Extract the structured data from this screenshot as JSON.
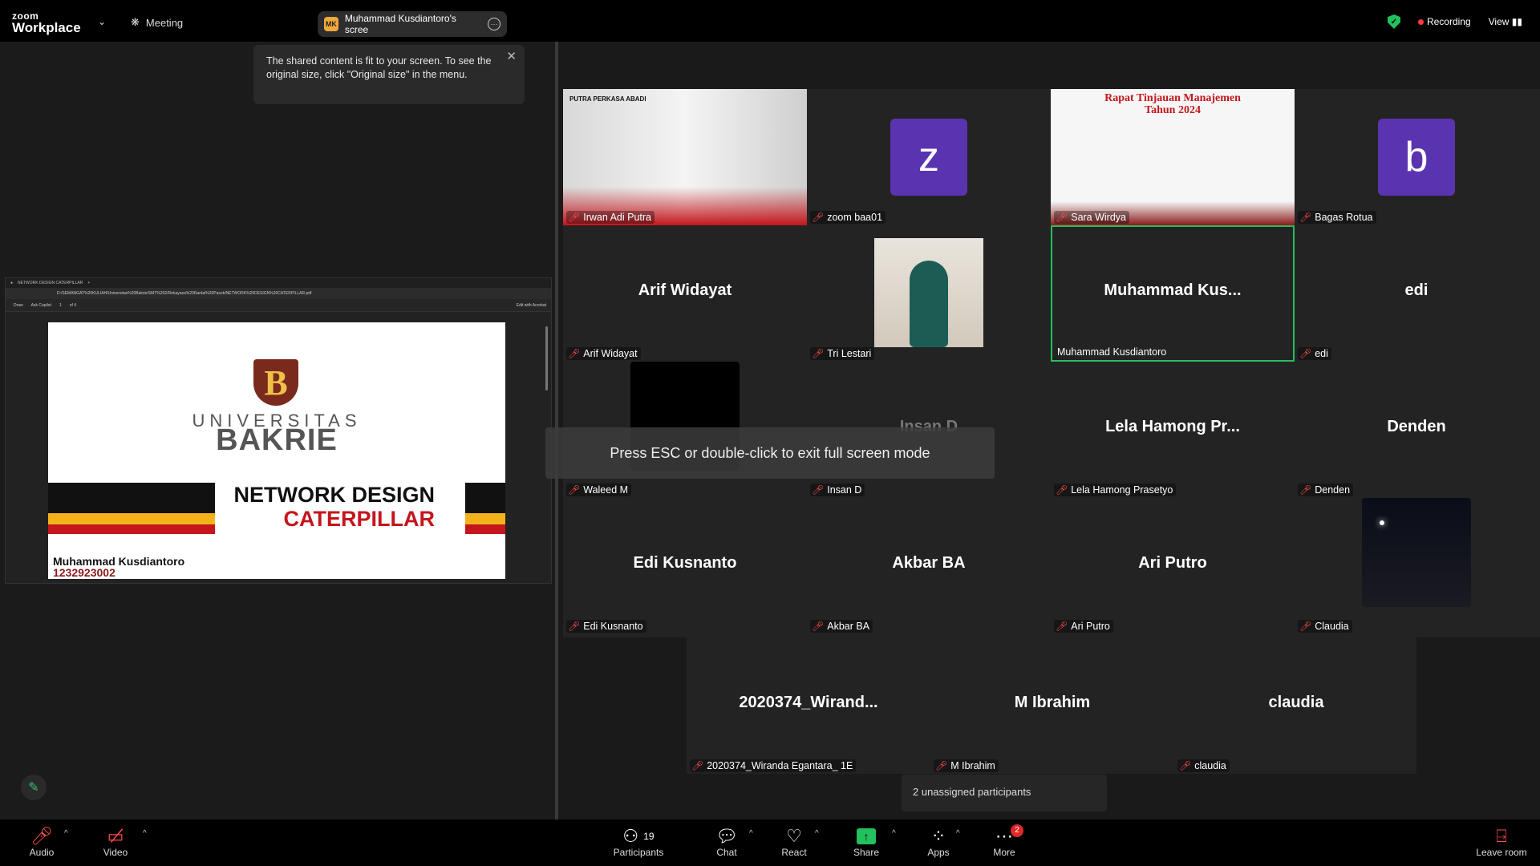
{
  "topbar": {
    "logo_line1": "zoom",
    "logo_line2": "Workplace",
    "meeting_label": "Meeting",
    "share_pill_initials": "MK",
    "share_pill_label": "Muhammad Kusdiantoro's scree",
    "recording_label": "Recording",
    "view_label": "View"
  },
  "tooltip": {
    "text": "The shared content is fit to your screen. To see the original size, click \"Original size\" in the menu."
  },
  "shared_screen": {
    "tab_title": "NETWORK DESIGN CATERPILLAR",
    "address": "D:/SEMANGAT%20KULIAH/Universitas%20Bakrie/SMT%202/Rekayasa%20Rantai%20Pasok/NETWORK%20DESIGN%20CATERPILLAR.pdf",
    "toolbar_draw": "Draw",
    "toolbar_copilot": "Ask Copilot",
    "toolbar_page": "1",
    "toolbar_of": "of 4",
    "toolbar_acrobat": "Edit with Acrobat",
    "slide": {
      "crest_letter": "B",
      "univ_line1": "UNIVERSITAS",
      "univ_line2": "BAKRIE",
      "title_line1": "NETWORK DESIGN",
      "title_line2": "CATERPILLAR",
      "author": "Muhammad Kusdiantoro",
      "nim": "1232923002"
    }
  },
  "gallery": {
    "tiles": [
      {
        "label": "Irwan Adi Putra",
        "name": ""
      },
      {
        "label": "zoom baa01",
        "name": "",
        "avatar": "z"
      },
      {
        "label": "Sara Wirdya",
        "name": ""
      },
      {
        "label": "Bagas Rotua",
        "name": "",
        "avatar": "b"
      },
      {
        "label": "Arif Widayat",
        "name": "Arif Widayat"
      },
      {
        "label": "Tri Lestari",
        "name": ""
      },
      {
        "label": "Muhammad Kusdiantoro",
        "name": "Muhammad Kus..."
      },
      {
        "label": "edi",
        "name": "edi"
      },
      {
        "label": "Waleed M",
        "name": ""
      },
      {
        "label": "Insan D",
        "name": "Insan D"
      },
      {
        "label": "Lela Hamong Prasetyo",
        "name": "Lela Hamong Pr..."
      },
      {
        "label": "Denden",
        "name": "Denden"
      },
      {
        "label": "Edi Kusnanto",
        "name": "Edi Kusnanto"
      },
      {
        "label": "Akbar BA",
        "name": "Akbar BA"
      },
      {
        "label": "Ari Putro",
        "name": "Ari Putro"
      },
      {
        "label": "Claudia",
        "name": ""
      },
      {
        "label": "2020374_Wiranda Egantara_ 1E",
        "name": "2020374_Wirand..."
      },
      {
        "label": "M Ibrahim",
        "name": "M Ibrahim"
      },
      {
        "label": "claudia",
        "name": "claudia"
      }
    ],
    "tile1_banner": "PUTRA PERKASA ABADI",
    "tile3_banner_line1": "Rapat Tinjauan Manajemen",
    "tile3_banner_line2": "Tahun 2024"
  },
  "esc_notice": "Press ESC or double-click to exit full screen mode",
  "unassigned": "2 unassigned participants",
  "bottombar": {
    "audio": "Audio",
    "video": "Video",
    "participants": "Participants",
    "participants_count": "19",
    "chat": "Chat",
    "react": "React",
    "share": "Share",
    "apps": "Apps",
    "more": "More",
    "more_badge": "2",
    "leave": "Leave room"
  },
  "colors": {
    "accent_green": "#23c05e",
    "recording_red": "#ff3b3b",
    "avatar_purple": "#5a34b0",
    "muted_red": "#ff4d4d"
  }
}
